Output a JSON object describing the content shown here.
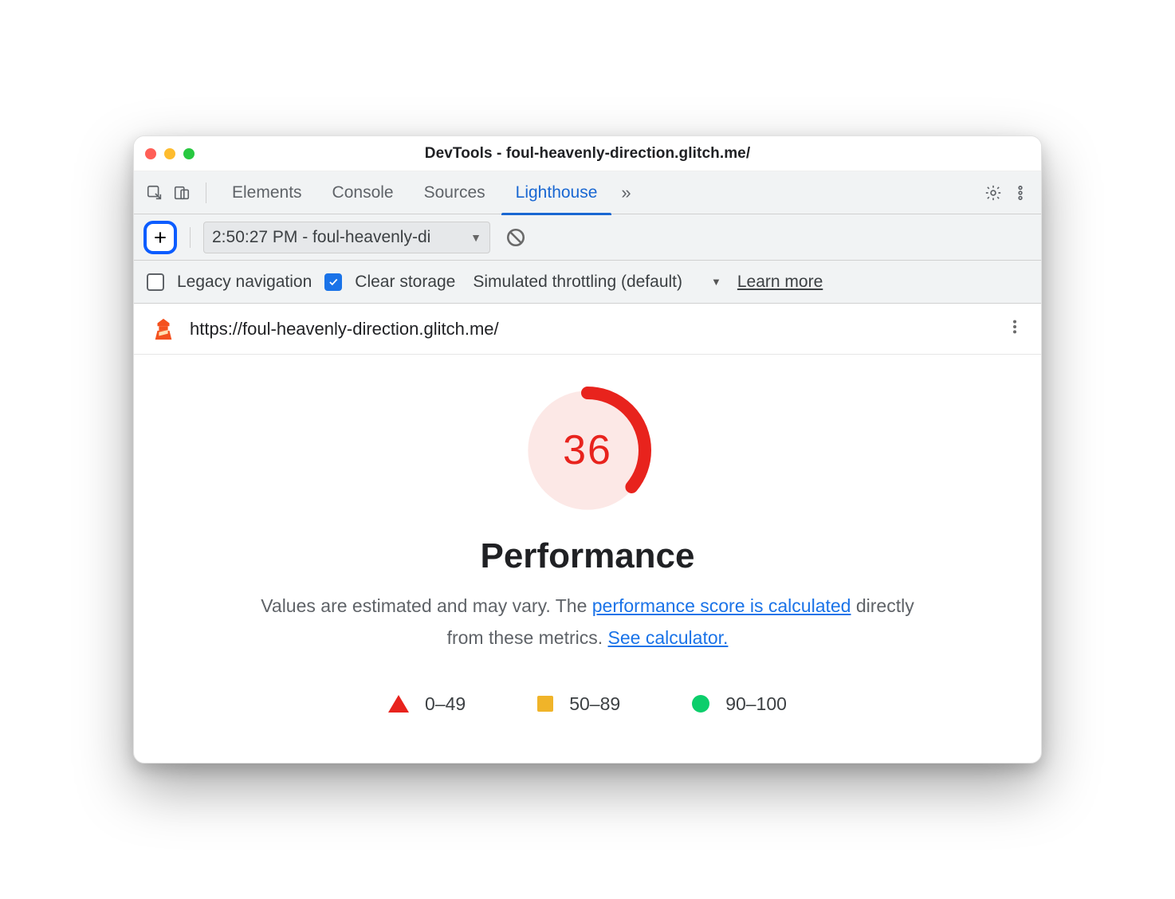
{
  "window": {
    "title": "DevTools - foul-heavenly-direction.glitch.me/"
  },
  "tabs": {
    "items": [
      "Elements",
      "Console",
      "Sources",
      "Lighthouse"
    ],
    "active_index": 3
  },
  "toolbar": {
    "report_select": "2:50:27 PM - foul-heavenly-di",
    "options": {
      "legacy_label": "Legacy navigation",
      "legacy_checked": false,
      "clear_label": "Clear storage",
      "clear_checked": true,
      "throttling_label": "Simulated throttling (default)",
      "learn_more": "Learn more"
    }
  },
  "report": {
    "url": "https://foul-heavenly-direction.glitch.me/",
    "category": "Performance",
    "score": 36,
    "arc_percent": 36,
    "desc_prefix": "Values are estimated and may vary. The ",
    "desc_link1": "performance score is calculated",
    "desc_mid": " directly from these metrics. ",
    "desc_link2": "See calculator.",
    "legend": {
      "fail": "0–49",
      "avg": "50–89",
      "pass": "90–100"
    }
  },
  "chart_data": {
    "type": "gauge",
    "title": "Performance",
    "value": 36,
    "range": [
      0,
      100
    ],
    "bands": [
      {
        "label": "0–49",
        "color": "#e8231d"
      },
      {
        "label": "50–89",
        "color": "#f0b429"
      },
      {
        "label": "90–100",
        "color": "#0cce6b"
      }
    ]
  }
}
